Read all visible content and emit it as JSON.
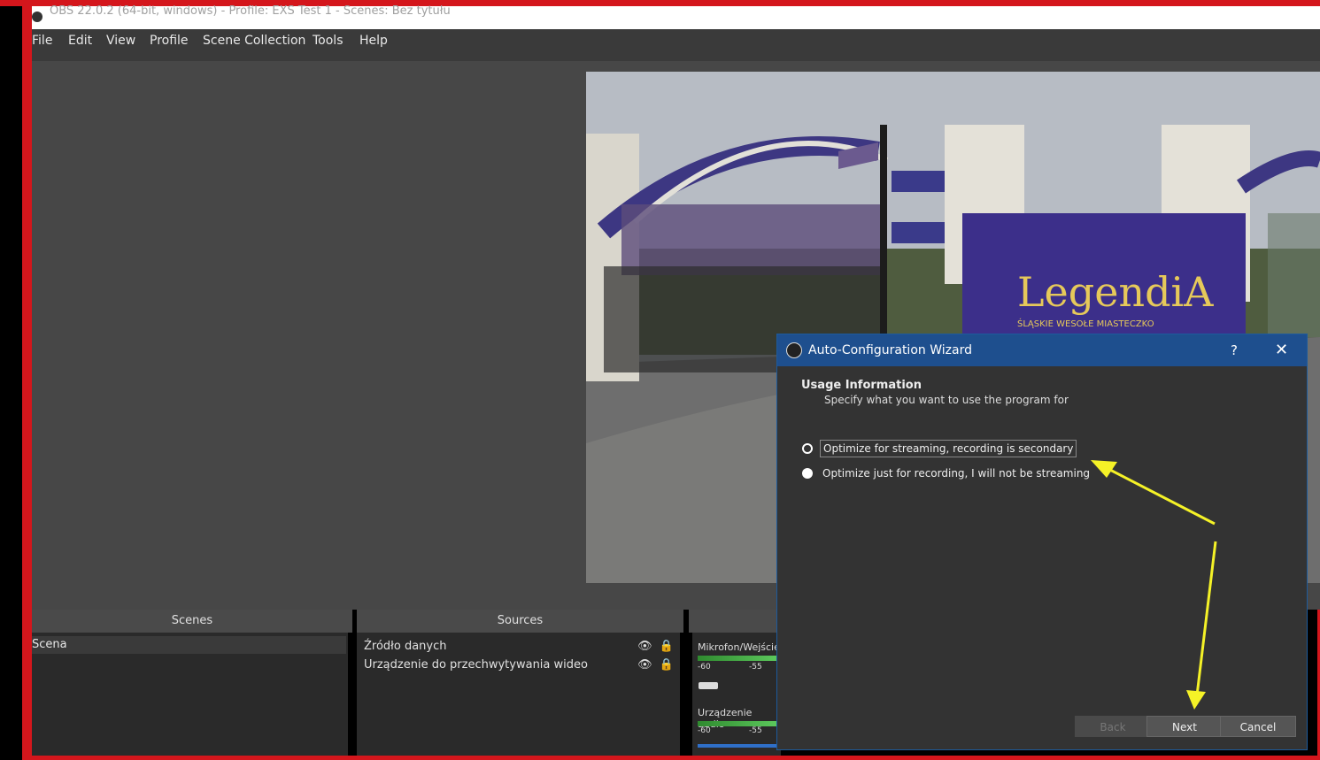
{
  "window": {
    "title": "OBS 22.0.2 (64-bit, windows) - Profile: EXS Test 1 - Scenes: Bez tytułu"
  },
  "menu": {
    "items": [
      {
        "label": "File"
      },
      {
        "label": "Edit"
      },
      {
        "label": "View"
      },
      {
        "label": "Profile"
      },
      {
        "label": "Scene Collection"
      },
      {
        "label": "Tools"
      },
      {
        "label": "Help"
      }
    ]
  },
  "preview": {
    "banner_text": "LegendiA",
    "banner_subtext": "ŚLĄSKIE WESOŁE MIASTECZKO"
  },
  "docks": {
    "scenes": {
      "header": "Scenes",
      "items": [
        {
          "label": "Scena"
        }
      ]
    },
    "sources": {
      "header": "Sources",
      "items": [
        {
          "label": "Źródło danych"
        },
        {
          "label": "Urządzenie do przechwytywania wideo"
        }
      ]
    },
    "mixer": {
      "channels": [
        {
          "label": "Mikrofon/Wejście",
          "tick_a": "-60",
          "tick_b": "-55"
        },
        {
          "label": "Urządzenie audio",
          "tick_a": "-60",
          "tick_b": "-55"
        }
      ]
    }
  },
  "dialog": {
    "title": "Auto-Configuration Wizard",
    "help_label": "?",
    "close_label": "✕",
    "section_title": "Usage Information",
    "section_subtitle": "Specify what you want to use the program for",
    "options": [
      {
        "label": "Optimize for streaming, recording is secondary",
        "selected": false,
        "focused": true
      },
      {
        "label": "Optimize just for recording, I will not be streaming",
        "selected": true,
        "focused": false
      }
    ],
    "buttons": {
      "back": "Back",
      "next": "Next",
      "cancel": "Cancel"
    }
  },
  "colors": {
    "frame_red": "#d4161c",
    "dialog_title_blue": "#1e4f8e",
    "annotation_arrow": "#f5f227"
  },
  "icons": {
    "obs_logo": "obs-logo-icon",
    "eye": "eye-icon",
    "lock": "lock-icon"
  }
}
